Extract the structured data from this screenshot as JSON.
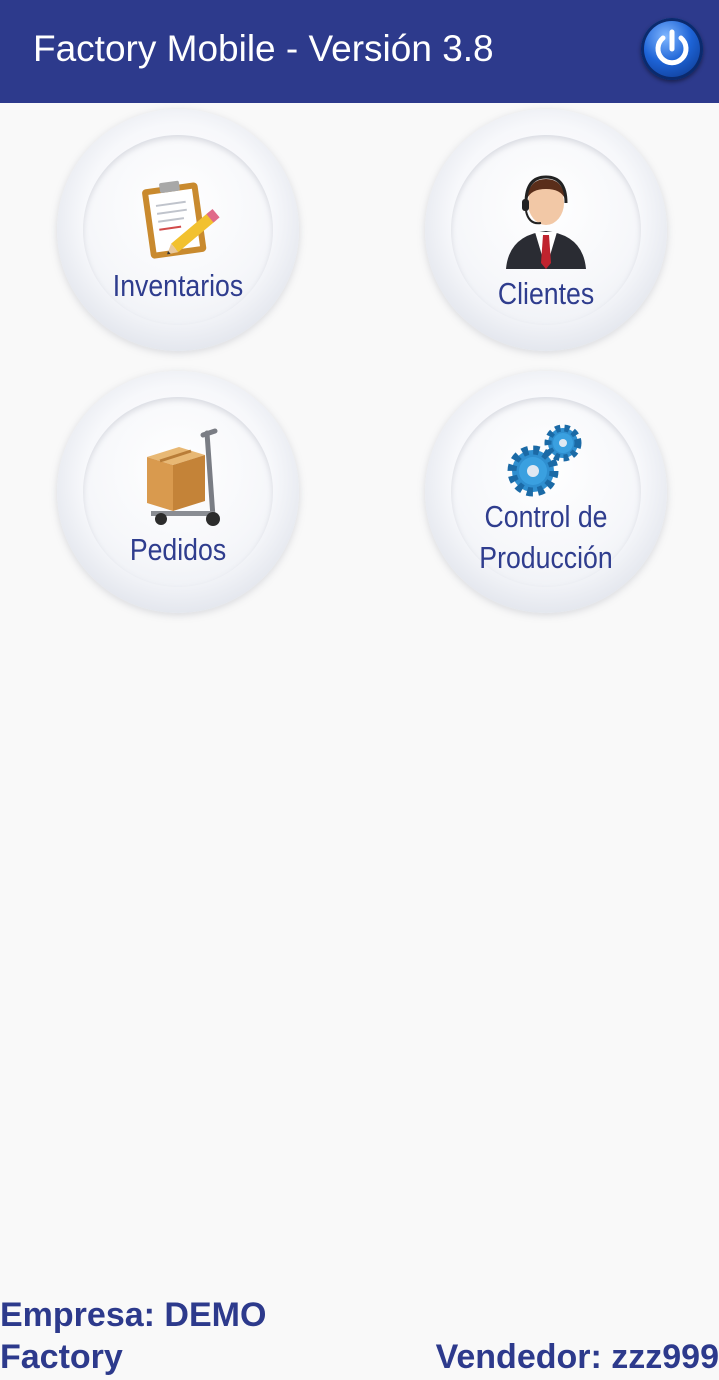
{
  "appbar": {
    "title": "Factory Mobile - Versión 3.8",
    "power_icon": "power-icon"
  },
  "menu": {
    "items": [
      {
        "label": "Inventarios",
        "icon": "clipboard-pencil-icon"
      },
      {
        "label": "Clientes",
        "icon": "customer-headset-icon"
      },
      {
        "label": "Pedidos",
        "icon": "hand-truck-box-icon"
      },
      {
        "label_line1": "Control de",
        "label_line2": "Producción",
        "icon": "gears-icon"
      }
    ]
  },
  "footer": {
    "company": "Empresa: DEMO",
    "company_line2": "Factory",
    "seller": "Vendedor: zzz999"
  },
  "colors": {
    "appbar": "#2d3a8c",
    "label": "#2f3d8e",
    "background": "#f9f9f9"
  }
}
